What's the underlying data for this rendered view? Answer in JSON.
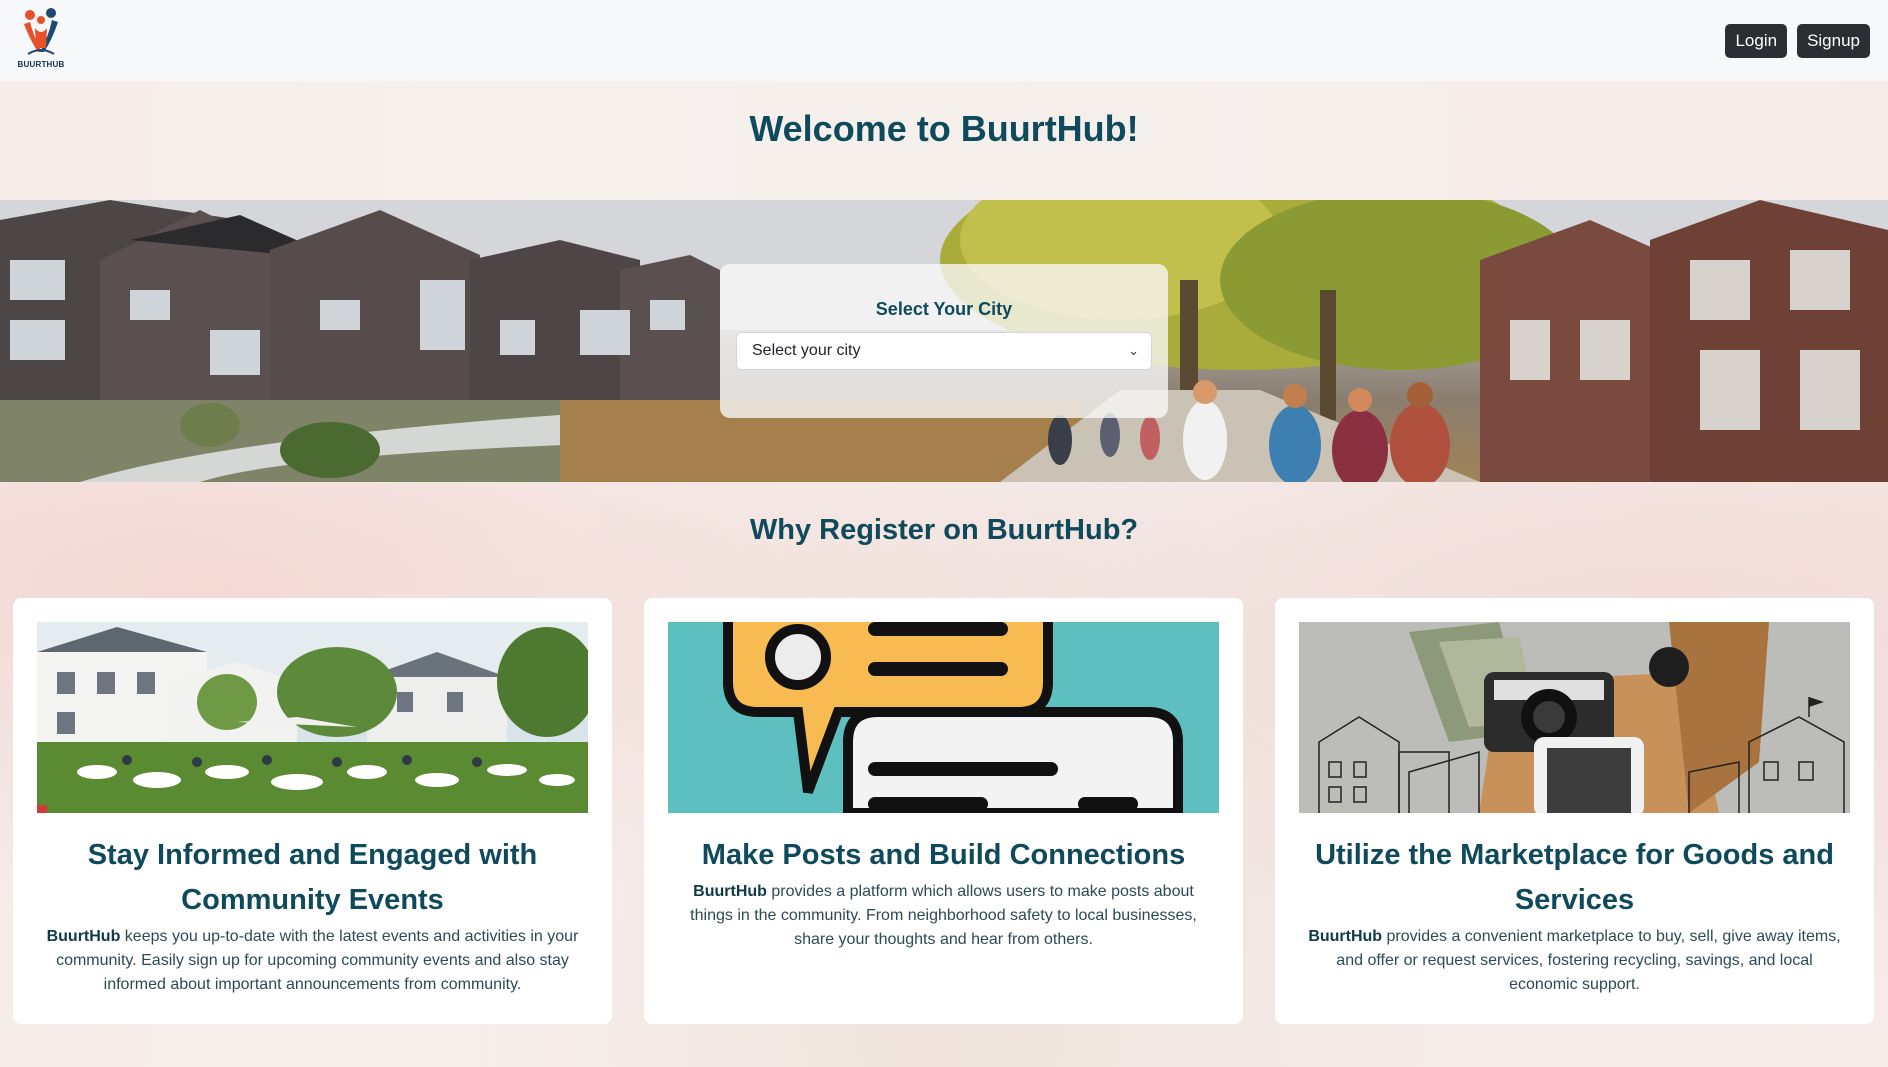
{
  "nav": {
    "logo_text": "BUURTHUB",
    "login_label": "Login",
    "signup_label": "Signup"
  },
  "welcome_title": "Welcome to BuurtHub!",
  "city": {
    "label": "Select Your City",
    "selected": "Select your city"
  },
  "why_title": "Why Register on BuurtHub?",
  "cards": [
    {
      "title": "Stay Informed and Engaged with Community Events",
      "brand": "BuurtHub",
      "text": " keeps you up-to-date with the latest events and activities in your community. Easily sign up for upcoming community events and also stay informed about important announcements from community."
    },
    {
      "title": "Make Posts and Build Connections",
      "brand": "BuurtHub",
      "text": " provides a platform which allows users to make posts about things in the community. From neighborhood safety to local businesses, share your thoughts and hear from others."
    },
    {
      "title": "Utilize the Marketplace for Goods and Services",
      "brand": "BuurtHub",
      "text": " provides a convenient marketplace to buy, sell, give away items, and offer or request services, fostering recycling, savings, and local economic support."
    }
  ],
  "colors": {
    "heading": "#0f4a5c",
    "button_bg": "#2b2f33",
    "navbar_bg": "#f7f8f9"
  }
}
